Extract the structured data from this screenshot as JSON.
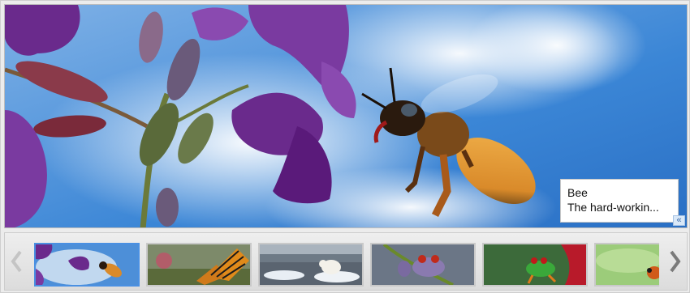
{
  "slideshow": {
    "current_slide": {
      "title": "Bee",
      "description": "The hard-workin..."
    },
    "caption_toggle_glyph": "«",
    "thumbnails": [
      {
        "name": "bee",
        "selected": true
      },
      {
        "name": "butterfly",
        "selected": false
      },
      {
        "name": "polar-bear",
        "selected": false
      },
      {
        "name": "frog-purple",
        "selected": false
      },
      {
        "name": "frog-green",
        "selected": false
      },
      {
        "name": "ladybug",
        "selected": false
      }
    ],
    "prev_icon": "chevron-left-icon",
    "next_icon": "chevron-right-icon"
  },
  "colors": {
    "sky": "#3b86d6",
    "flower_purple": "#6a2a8c",
    "bee_orange": "#d98a2a",
    "selected_border": "#4a90e2"
  }
}
